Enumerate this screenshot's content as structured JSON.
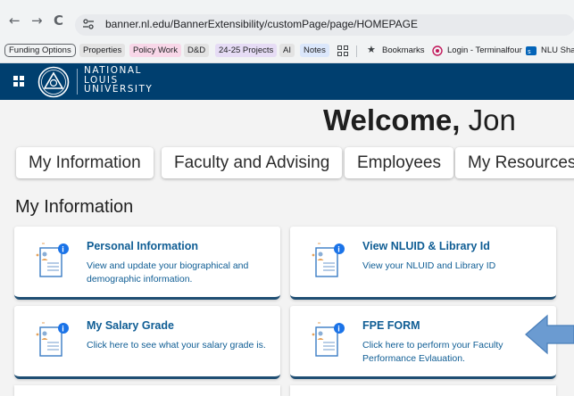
{
  "browser": {
    "nav": {
      "back": "←",
      "forward": "→",
      "reload": "C"
    },
    "url": "banner.nl.edu/BannerExtensibility/customPage/page/HOMEPAGE",
    "bookmarks": [
      "Funding Options",
      "Properties",
      "Policy Work",
      "D&D",
      "24-25 Projects",
      "AI",
      "Notes",
      "Bookmarks",
      "Login - Terminalfour",
      "NLU Sha"
    ]
  },
  "header": {
    "brand_lines": [
      "NATIONAL",
      "LOUIS",
      "UNIVERSITY"
    ]
  },
  "welcome": {
    "greeting": "Welcome,",
    "name": "Jon"
  },
  "tabs": [
    "My Information",
    "Faculty and Advising",
    "Employees",
    "My Resources"
  ],
  "section": {
    "title": "My Information"
  },
  "cards": [
    {
      "title": "Personal Information",
      "description": "View and update your biographical and demographic information."
    },
    {
      "title": "View NLUID & Library Id",
      "description": "View your NLUID and Library ID"
    },
    {
      "title": "My Salary Grade",
      "description": "Click here to see what your salary grade is."
    },
    {
      "title": "FPE FORM",
      "description": "Click here to perform your Faculty Performance Evlauation."
    }
  ],
  "colors": {
    "header_bg": "#003f6f",
    "card_text": "#0f5d94",
    "card_border": "#1f4e73",
    "arrow": "#6b9bd1",
    "info_badge": "#1a73e8"
  }
}
